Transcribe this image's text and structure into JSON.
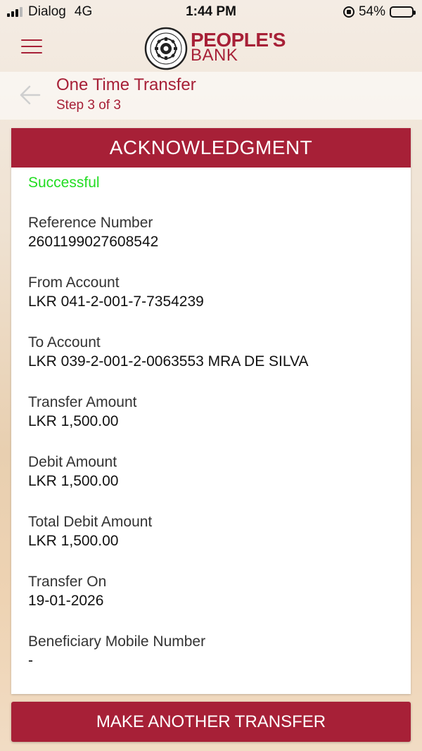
{
  "status_bar": {
    "carrier": "Dialog",
    "network": "4G",
    "time": "1:44 PM",
    "battery": "54%",
    "battery_level": 0.54
  },
  "header": {
    "menu_icon": "hamburger-menu-icon",
    "logo_line1": "PEOPLE'S",
    "logo_line2": "BANK",
    "brand_color": "#a72037"
  },
  "sub_header": {
    "back_icon": "arrow-left-icon",
    "title": "One Time Transfer",
    "step": "Step 3 of 3"
  },
  "card": {
    "heading": "ACKNOWLEDGMENT",
    "status": "Successful",
    "status_color": "#22dd22",
    "fields": [
      {
        "label": "Reference Number",
        "value": "2601199027608542"
      },
      {
        "label": "From Account",
        "value": "LKR 041-2-001-7-7354239"
      },
      {
        "label": "To Account",
        "value": "LKR 039-2-001-2-0063553 MRA DE SILVA"
      },
      {
        "label": "Transfer Amount",
        "value": "LKR 1,500.00"
      },
      {
        "label": "Debit Amount",
        "value": "LKR 1,500.00"
      },
      {
        "label": "Total Debit Amount",
        "value": "LKR 1,500.00"
      },
      {
        "label": "Transfer On",
        "value": "19-01-2026"
      },
      {
        "label": "Beneficiary Mobile Number",
        "value": "-"
      }
    ]
  },
  "action_button": "MAKE ANOTHER TRANSFER"
}
